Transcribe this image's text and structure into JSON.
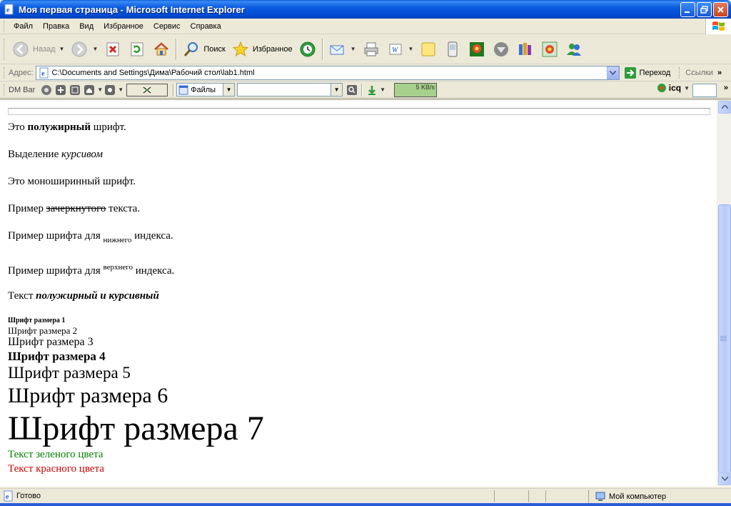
{
  "window": {
    "title": "Моя первая страница - Microsoft Internet Explorer"
  },
  "menu": [
    {
      "label": "Файл",
      "name": "menu-file"
    },
    {
      "label": "Правка",
      "name": "menu-edit"
    },
    {
      "label": "Вид",
      "name": "menu-view"
    },
    {
      "label": "Избранное",
      "name": "menu-favorites"
    },
    {
      "label": "Сервис",
      "name": "menu-tools"
    },
    {
      "label": "Справка",
      "name": "menu-help"
    }
  ],
  "toolbar": {
    "back_label": "Назад",
    "search_label": "Поиск",
    "favorites_label": "Избранное"
  },
  "address": {
    "label": "Адрес:",
    "url": "C:\\Documents and Settings\\Дима\\Рабочий стол\\lab1.html",
    "go_label": "Переход",
    "links_label": "Ссылки"
  },
  "dmbar": {
    "label": "DM Bar",
    "files_label": "Файлы",
    "speed": "5 KB/s",
    "icq_label": "icq"
  },
  "page": {
    "bold_pre": "Это ",
    "bold_word": "полужирный",
    "bold_post": " шрифт.",
    "italic_pre": "Выделение ",
    "italic_word": "курсивом",
    "mono_line": "Это моноширинный шрифт.",
    "strike_pre": "Пример ",
    "strike_word": "зачеркнутого",
    "strike_post": " текста.",
    "sub_pre": "Пример шрифта для ",
    "sub_word": "нижнего",
    "sub_post": " индекса.",
    "sup_pre": "Пример шрифта для ",
    "sup_word": "верхнего",
    "sup_post": " индекса.",
    "bi_pre": "Текст ",
    "bi_word": "полужирный и курсивный",
    "size1": "Шрифт размера 1",
    "size2": "Шрифт размера 2",
    "size3": "Шрифт размера 3",
    "size4": "Шрифт размера 4",
    "size5": "Шрифт размера 5",
    "size6": "Шрифт размера 6",
    "size7": "Шрифт размера 7",
    "green_text": "Текст зеленого цвета",
    "red_text": "Текст красного цвета"
  },
  "status": {
    "left": "Готово",
    "zone": "Мой компьютер"
  },
  "colors": {
    "green": "#008000",
    "red": "#cc0000",
    "titlebar": "#0b5ce0"
  }
}
